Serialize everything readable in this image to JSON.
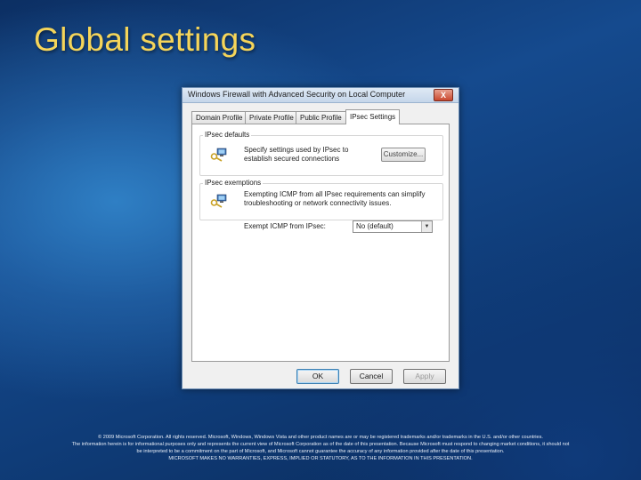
{
  "slide": {
    "title": "Global settings"
  },
  "dialog": {
    "title": "Windows Firewall with Advanced Security on Local Computer",
    "close_glyph": "X",
    "tabs": [
      {
        "label": "Domain Profile"
      },
      {
        "label": "Private Profile"
      },
      {
        "label": "Public Profile"
      },
      {
        "label": "IPsec Settings",
        "active": true
      }
    ],
    "ipsec_defaults": {
      "label": "IPsec defaults",
      "text_line1": "Specify settings used by IPsec to",
      "text_line2": "establish secured connections",
      "button": "Customize..."
    },
    "ipsec_exemptions": {
      "label": "IPsec exemptions",
      "text_line1": "Exempting ICMP from all IPsec requirements can simplify",
      "text_line2": "troubleshooting or network connectivity issues.",
      "select_label": "Exempt ICMP from IPsec:",
      "select_value": "No (default)"
    },
    "buttons": {
      "ok": "OK",
      "cancel": "Cancel",
      "apply": "Apply"
    }
  },
  "footer": {
    "line1": "© 2009 Microsoft Corporation. All rights reserved. Microsoft, Windows, Windows Vista and other product names are or may be registered trademarks and/or trademarks in the U.S. and/or other countries.",
    "line2": "The information herein is for informational purposes only and represents the current view of Microsoft Corporation as of the date of this presentation. Because Microsoft must respond to changing market conditions, it should not",
    "line3": "be interpreted to be a commitment on the part of Microsoft, and Microsoft cannot guarantee the accuracy of any information provided after the date of this presentation.",
    "line4": "MICROSOFT MAKES NO WARRANTIES, EXPRESS, IMPLIED OR STATUTORY, AS TO THE INFORMATION IN THIS PRESENTATION."
  }
}
